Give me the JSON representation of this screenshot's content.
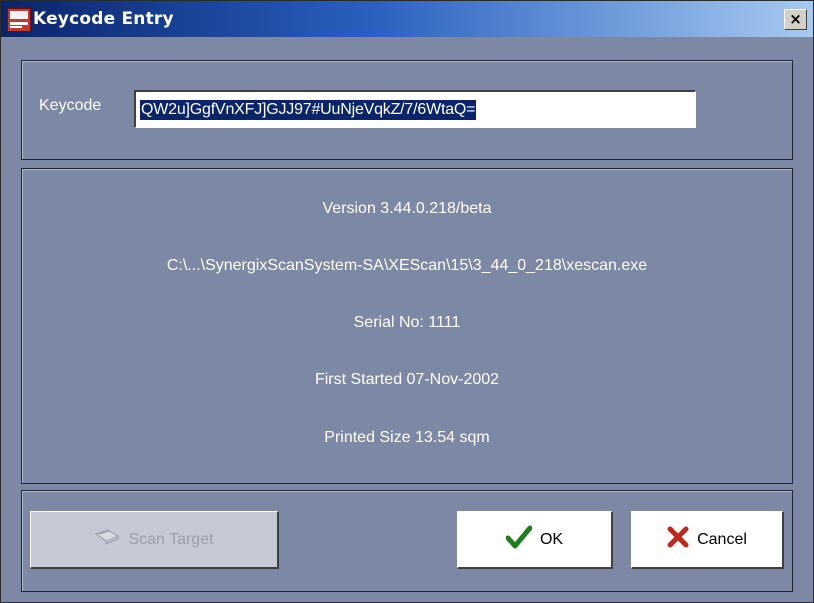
{
  "window": {
    "title": "Keycode Entry",
    "close_label": "×"
  },
  "keycode": {
    "label": "Keycode",
    "value": "QW2u]GgfVnXFJ]GJJ97#UuNjeVqkZ/7/6WtaQ="
  },
  "info": {
    "version": "Version 3.44.0.218/beta",
    "path": "C:\\...\\SynergixScanSystem-SA\\XEScan\\15\\3_44_0_218\\xescan.exe",
    "serial": "Serial No: 1111",
    "first_started": "First Started 07-Nov-2002",
    "printed_size": "Printed Size 13.54 sqm"
  },
  "buttons": {
    "scan_target": {
      "label": "Scan Target",
      "icon": "scanner-icon",
      "enabled": false
    },
    "ok": {
      "label": "OK",
      "icon": "checkmark-icon",
      "color": "#1e7e1e"
    },
    "cancel": {
      "label": "Cancel",
      "icon": "cross-icon",
      "color": "#c0281e"
    }
  }
}
